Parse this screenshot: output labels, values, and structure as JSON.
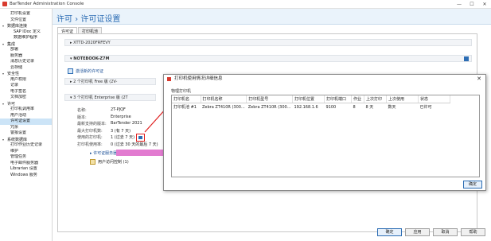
{
  "app": {
    "title": "BarTender Administration Console",
    "controls": [
      "—",
      "☐",
      "✕"
    ]
  },
  "sidebar": {
    "items": [
      {
        "label": "打印机设置",
        "level": "sub"
      },
      {
        "label": "文件位置",
        "level": "sub"
      },
      {
        "label": "数据库连接",
        "level": "grp",
        "toggle": "▾"
      },
      {
        "label": "SAP IDoc 定义",
        "level": "sub2"
      },
      {
        "label": "数据维护程序",
        "level": "sub2"
      },
      {
        "label": "集成",
        "level": "grp",
        "toggle": "▾"
      },
      {
        "label": "部署",
        "level": "sub"
      },
      {
        "label": "服务器",
        "level": "sub"
      },
      {
        "label": "消息历史记录",
        "level": "sub"
      },
      {
        "label": "云存储",
        "level": "sub"
      },
      {
        "label": "安全性",
        "level": "grp",
        "toggle": "▾"
      },
      {
        "label": "用户权限",
        "level": "sub"
      },
      {
        "label": "记录",
        "level": "sub"
      },
      {
        "label": "电子签名",
        "level": "sub"
      },
      {
        "label": "文档加密",
        "level": "sub"
      },
      {
        "label": "许可",
        "level": "grp",
        "toggle": "▾"
      },
      {
        "label": "打印机调用率",
        "level": "sub"
      },
      {
        "label": "用户活动",
        "level": "sub"
      },
      {
        "label": "许可证设置",
        "level": "sub",
        "selected": true
      },
      {
        "label": "冗余",
        "level": "sub"
      },
      {
        "label": "警报设置",
        "level": "sub"
      },
      {
        "label": "系统数据库",
        "level": "grp",
        "toggle": "▾"
      },
      {
        "label": "打印作业历史记录",
        "level": "sub"
      },
      {
        "label": "维护",
        "level": "sub"
      },
      {
        "label": "管理任务",
        "level": "sub"
      },
      {
        "label": "电子邮件服务器",
        "level": "plain"
      },
      {
        "label": "Librarian 设置",
        "level": "plain"
      },
      {
        "label": "Windows 服务",
        "level": "plain"
      }
    ]
  },
  "header": {
    "crumb": "许可 › 许可证设置"
  },
  "tabs": [
    "许可证",
    "打印机池"
  ],
  "content": {
    "server1": "XTTD-2020FRFEVY",
    "server2": "NOTEBOOK-Z7M",
    "add_license": "激活新的许可证",
    "group_free": "2 个打印机 Free 版 (2V-",
    "group_enterprise": "3 个打印机 Enterprise 版 (2T",
    "fields": [
      {
        "label": "名称:",
        "value": "2T-PJQF"
      },
      {
        "label": "版本:",
        "value": "Enterprise"
      },
      {
        "label": "最新支持的版本:",
        "value": "BarTender 2021"
      },
      {
        "label": "最大打印机数:",
        "value": "3   (有 7 天)"
      },
      {
        "label": "使用的打印机:",
        "value": "1   (过去 7 天)"
      },
      {
        "label": "打印机使用率:",
        "value": "0   (过去 30 天的最后 7 天)"
      }
    ],
    "license_server": "许可证服务器",
    "user_control": "用户访问控制 (1)"
  },
  "dialog": {
    "title": "打印机使用情况详细信息",
    "close": "✕",
    "group_label": "物理打印机",
    "columns": [
      "打印机名",
      "打印机名称",
      "打印机型号",
      "打印机位置",
      "打印机端口",
      "作业",
      "上次打印",
      "上次使用",
      "状态"
    ],
    "rows": [
      [
        "打印机池 #1",
        "Zebra ZT410R (300...",
        "Zebra ZT410R (300...",
        "192.168.1.6",
        "9100",
        "8",
        "8 天",
        "数天",
        "已许可"
      ]
    ],
    "ok_label": "确定"
  },
  "footer": {
    "buttons": [
      "确定",
      "应用",
      "取消",
      "帮助"
    ]
  }
}
